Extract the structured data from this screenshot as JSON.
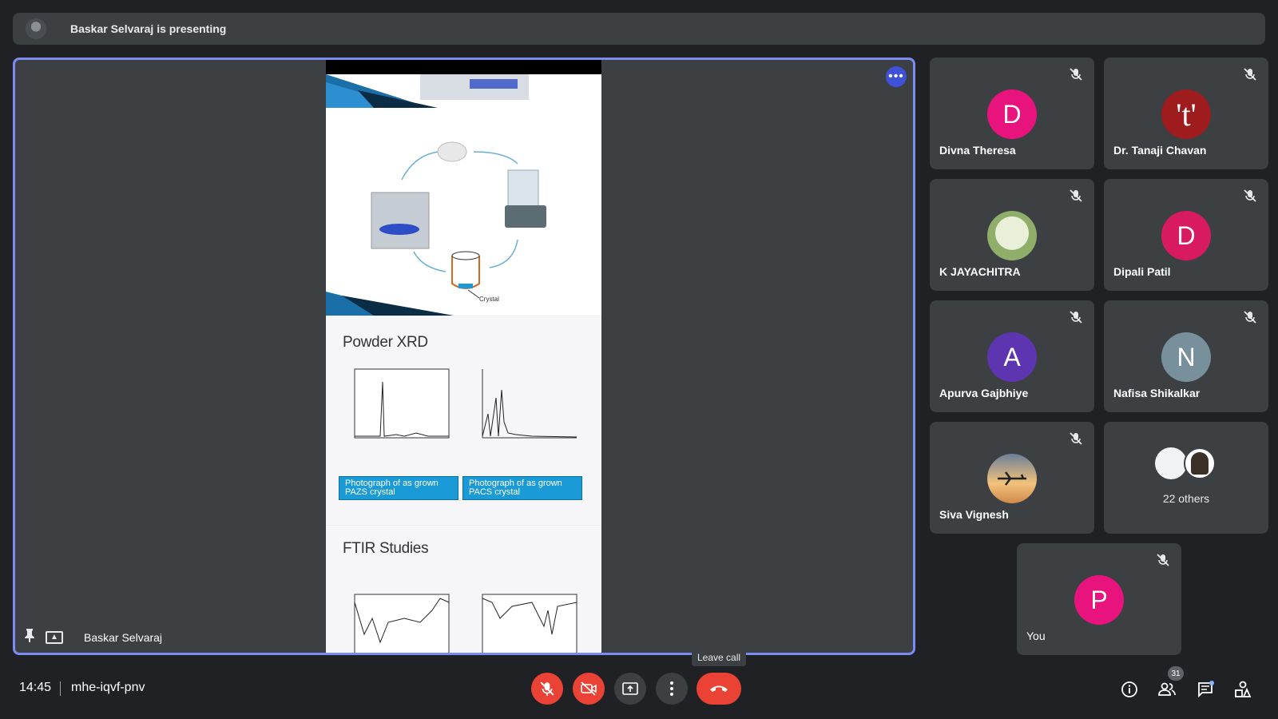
{
  "banner": {
    "presenting_text": "Baskar Selvaraj is presenting"
  },
  "stage": {
    "presenter_name": "Baskar Selvaraj",
    "slide": {
      "crystal_label": "Crystal",
      "powder_title": "Powder XRD",
      "caption_left": "Photograph of as grown PAZS crystal",
      "caption_right": "Photograph of as grown PACS crystal",
      "ftir_title": "FTIR Studies"
    }
  },
  "participants": [
    {
      "name": "Divna Theresa",
      "initial": "D",
      "color": "#e8137c",
      "muted": true
    },
    {
      "name": "Dr. Tanaji Chavan",
      "initial": "'t'",
      "color": "#9e1b1e",
      "muted": true
    },
    {
      "name": "K JAYACHITRA",
      "initial": "",
      "color": "#c9d8b0",
      "muted": true
    },
    {
      "name": "Dipali Patil",
      "initial": "D",
      "color": "#d81b60",
      "muted": true
    },
    {
      "name": "Apurva Gajbhiye",
      "initial": "A",
      "color": "#5e35b1",
      "muted": true
    },
    {
      "name": "Nafisa Shikalkar",
      "initial": "N",
      "color": "#78909c",
      "muted": true
    },
    {
      "name": "Siva Vignesh",
      "initial": "",
      "color": "#d9a86c",
      "muted": true
    }
  ],
  "others": {
    "label": "22 others"
  },
  "self": {
    "name": "You",
    "initial": "P",
    "color": "#e8137c"
  },
  "bottom": {
    "time": "14:45",
    "meeting_code": "mhe-iqvf-pnv",
    "leave_tooltip": "Leave call",
    "people_count": "31"
  }
}
